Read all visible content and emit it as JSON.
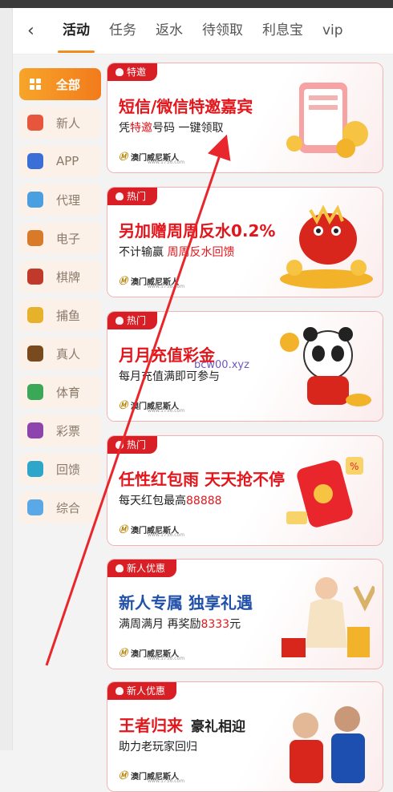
{
  "header": {
    "back_icon": "chevron-left-icon",
    "tabs": [
      "活动",
      "任务",
      "返水",
      "待领取",
      "利息宝",
      "vip"
    ],
    "active_tab": "活动"
  },
  "sidebar": {
    "items": [
      {
        "label": "全部",
        "icon": "grid-icon",
        "color": "#f5a623"
      },
      {
        "label": "新人",
        "icon": "medal-icon",
        "color": "#e8553d"
      },
      {
        "label": "APP",
        "icon": "phone-icon",
        "color": "#3a6fd8"
      },
      {
        "label": "代理",
        "icon": "handshake-icon",
        "color": "#4a9fe0"
      },
      {
        "label": "电子",
        "icon": "slot-icon",
        "color": "#d97a2b"
      },
      {
        "label": "棋牌",
        "icon": "cards-icon",
        "color": "#c0392b"
      },
      {
        "label": "捕鱼",
        "icon": "fish-icon",
        "color": "#e6b12b"
      },
      {
        "label": "真人",
        "icon": "dealer-icon",
        "color": "#7a4a1f"
      },
      {
        "label": "体育",
        "icon": "soccer-icon",
        "color": "#3aa856"
      },
      {
        "label": "彩票",
        "icon": "lottery-icon",
        "color": "#8e44ad"
      },
      {
        "label": "回馈",
        "icon": "feedback-icon",
        "color": "#2ea6c9"
      },
      {
        "label": "综合",
        "icon": "layers-icon",
        "color": "#5aa9e6"
      }
    ]
  },
  "cards": [
    {
      "badge": "特邀",
      "title": "短信/微信特邀嘉宾",
      "title_suffix": "",
      "sub_parts": [
        "凭",
        "特邀",
        "号码   一键领取"
      ],
      "art": "phone-coins-art"
    },
    {
      "badge": "热门",
      "title": "另加赠周周反水0.2%",
      "title_suffix": "",
      "sub_parts": [
        "不计输赢  ",
        "周周反水回馈",
        ""
      ],
      "art": "dragon-art"
    },
    {
      "badge": "热门",
      "title": "月月充值彩金",
      "title_suffix": "",
      "sub_parts": [
        "每月充值满",
        "",
        "即可参与"
      ],
      "art": "panda-art"
    },
    {
      "badge": "热门",
      "title": "任性红包雨  天天抢不停",
      "title_suffix": "",
      "sub_parts": [
        "每天红包最高",
        "88888",
        ""
      ],
      "art": "redpacket-art"
    },
    {
      "badge": "新人优惠",
      "title": "新人专属 独享礼遇",
      "title_suffix": "",
      "sub_parts": [
        "满周满月 再奖励",
        "8333",
        "元"
      ],
      "art": "gift-lady-art"
    },
    {
      "badge": "新人优惠",
      "title": "王者归来",
      "title_suffix": "豪礼相迎",
      "sub_parts": [
        "助力老玩家回归",
        "",
        ""
      ],
      "art": "players-art"
    }
  ],
  "logo": {
    "mark": "Ⓜ",
    "text": "澳门威尼斯人",
    "url": "www.1756.com"
  },
  "watermark": "bcw00.xyz"
}
